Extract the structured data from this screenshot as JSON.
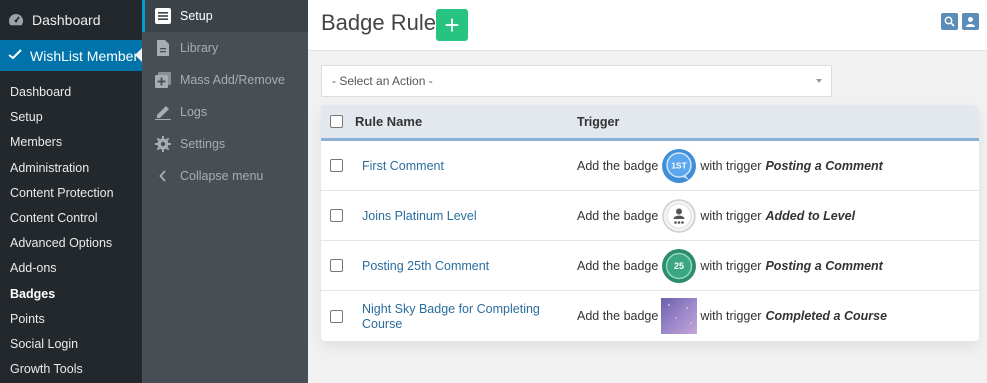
{
  "wp_menu": {
    "dashboard_label": "Dashboard",
    "active_label": "WishList Member",
    "sub_items": [
      "Dashboard",
      "Setup",
      "Members",
      "Administration",
      "Content Protection",
      "Content Control",
      "Advanced Options",
      "Add-ons",
      "Badges",
      "Points",
      "Social Login",
      "Growth Tools"
    ],
    "current_item": "Badges"
  },
  "plugin_nav": {
    "items": [
      {
        "label": "Setup",
        "icon": "list-icon",
        "active": true
      },
      {
        "label": "Library",
        "icon": "file-icon",
        "active": false
      },
      {
        "label": "Mass Add/Remove",
        "icon": "plus-box-icon",
        "active": false
      },
      {
        "label": "Logs",
        "icon": "pencil-icon",
        "active": false
      },
      {
        "label": "Settings",
        "icon": "gear-icon",
        "active": false
      },
      {
        "label": "Collapse menu",
        "icon": "chevron-left-icon",
        "active": false
      }
    ]
  },
  "header": {
    "title": "Badge Rules",
    "add_label": "+"
  },
  "action_select": {
    "value": "- Select an Action -"
  },
  "table": {
    "headers": {
      "name": "Rule Name",
      "trigger": "Trigger"
    },
    "trigger_prefix": "Add the badge",
    "trigger_middle": "with trigger",
    "rows": [
      {
        "name": "First Comment",
        "badge": "1ST",
        "badge_kind": "speech-blue",
        "trigger": "Posting a Comment"
      },
      {
        "name": "Joins Platinum Level",
        "badge": "",
        "badge_kind": "platinum-grey",
        "trigger": "Added to Level"
      },
      {
        "name": "Posting 25th Comment",
        "badge": "25",
        "badge_kind": "green-circle",
        "trigger": "Posting a Comment"
      },
      {
        "name": "Night Sky Badge for Completing Course",
        "badge": "",
        "badge_kind": "night-sky-image",
        "trigger": "Completed a Course"
      }
    ]
  },
  "colors": {
    "wp_sidebar": "#23282d",
    "wp_active": "#0073aa",
    "plugin_nav": "#474e54",
    "add_button": "#27c481",
    "link": "#2a6d9e",
    "header_underline": "#8cb0d6"
  }
}
